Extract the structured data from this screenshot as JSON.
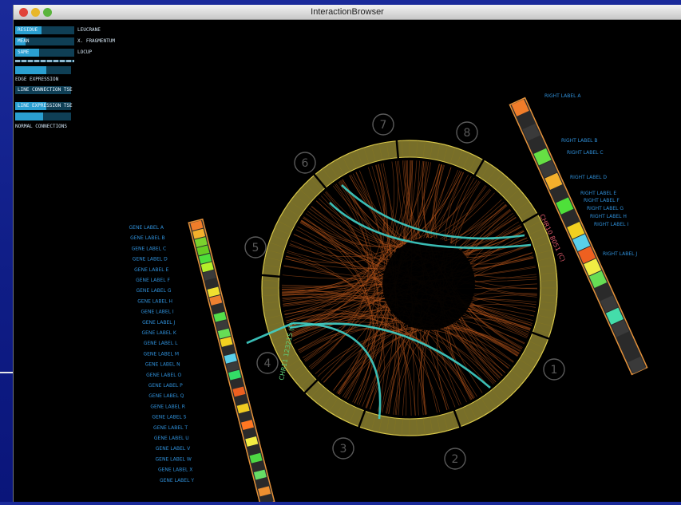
{
  "window": {
    "title": "InteractionBrowser"
  },
  "controls": {
    "rows": [
      {
        "label": "RESIDUE",
        "value": "LEUCRANE",
        "fill": 0.45
      },
      {
        "label": "MEAN",
        "value": "X. FRAGMENTUM",
        "fill": 0.18
      },
      {
        "label": "SAME",
        "value": "LOCUP",
        "fill": 0.4
      }
    ],
    "sliders": [
      {
        "label": "EDGE EXPRESSION",
        "fill": 0.55
      },
      {
        "label": "LINE CONNECTION TSE",
        "fill": 0.0
      },
      {
        "label": "LINE EXPRESSION TSE",
        "fill": 0.55
      }
    ],
    "bottom_label": "NORMAL CONNECTIONS"
  },
  "ring_labels": [
    "1",
    "2",
    "3",
    "4",
    "5",
    "6",
    "7",
    "8"
  ],
  "left_chromosome": {
    "name": "CHR11 123215 (F)",
    "bands": [
      "#f07d2a",
      "#f4b02c",
      "#7bd12d",
      "#66cc22",
      "#4ee03a",
      "#b4ef2a",
      "#3a3a3a",
      "#2a2a2a",
      "#f0e030",
      "#ee8030",
      "#2a2a2a",
      "#54e04a",
      "#3a3a3a",
      "#66dd55",
      "#f2d020",
      "#2a2a2a",
      "#5ad0ea",
      "#3a3a3a",
      "#33dd66",
      "#2a2a2a",
      "#ee6020",
      "#2a2a2a",
      "#f0cc22",
      "#2a2a2a",
      "#ff7722",
      "#2a2a2a",
      "#f2ec44",
      "#2a2a2a",
      "#4ed844",
      "#2a2a2a",
      "#66dd66",
      "#2a2a2a",
      "#ee9030",
      "#2a2a2a"
    ],
    "labels": [
      "GENE LABEL A",
      "GENE LABEL B",
      "GENE LABEL C",
      "GENE LABEL D",
      "GENE LABEL E",
      "GENE LABEL F",
      "GENE LABEL G",
      "GENE LABEL H",
      "GENE LABEL I",
      "GENE LABEL J",
      "GENE LABEL K",
      "GENE LABEL L",
      "GENE LABEL M",
      "GENE LABEL N",
      "GENE LABEL O",
      "GENE LABEL P",
      "GENE LABEL Q",
      "GENE LABEL R",
      "GENE LABEL S",
      "GENE LABEL T",
      "GENE LABEL U",
      "GENE LABEL V",
      "GENE LABEL W",
      "GENE LABEL X",
      "GENE LABEL Y"
    ]
  },
  "right_chromosome": {
    "name": "CHR10 8051 (C)",
    "bands": [
      "#f07d2a",
      "#2a2a2a",
      "#3a3a3a",
      "#2a2a2a",
      "#66e044",
      "#3a3a3a",
      "#f4b02c",
      "#2a2a2a",
      "#4ee03a",
      "#2a2a2a",
      "#f2d020",
      "#5ad0ea",
      "#ee6020",
      "#f0ec44",
      "#66dd55",
      "#2a2a2a",
      "#3a3a3a",
      "#44ddaa",
      "#3a3a3a",
      "#2a2a2a",
      "#2a2a2a",
      "#3a3a3a"
    ],
    "labels": [
      "RIGHT LABEL A",
      "RIGHT LABEL B",
      "RIGHT LABEL C",
      "RIGHT LABEL D",
      "RIGHT LABEL E",
      "RIGHT LABEL F",
      "RIGHT LABEL G",
      "RIGHT LABEL H",
      "RIGHT LABEL I",
      "RIGHT LABEL J"
    ]
  },
  "colors": {
    "ring": "#d9c84a",
    "web": "#b8561c",
    "highlight": "#3fd0c8",
    "label": "#2f8fd8",
    "ring_number": "#5a5a5a"
  }
}
